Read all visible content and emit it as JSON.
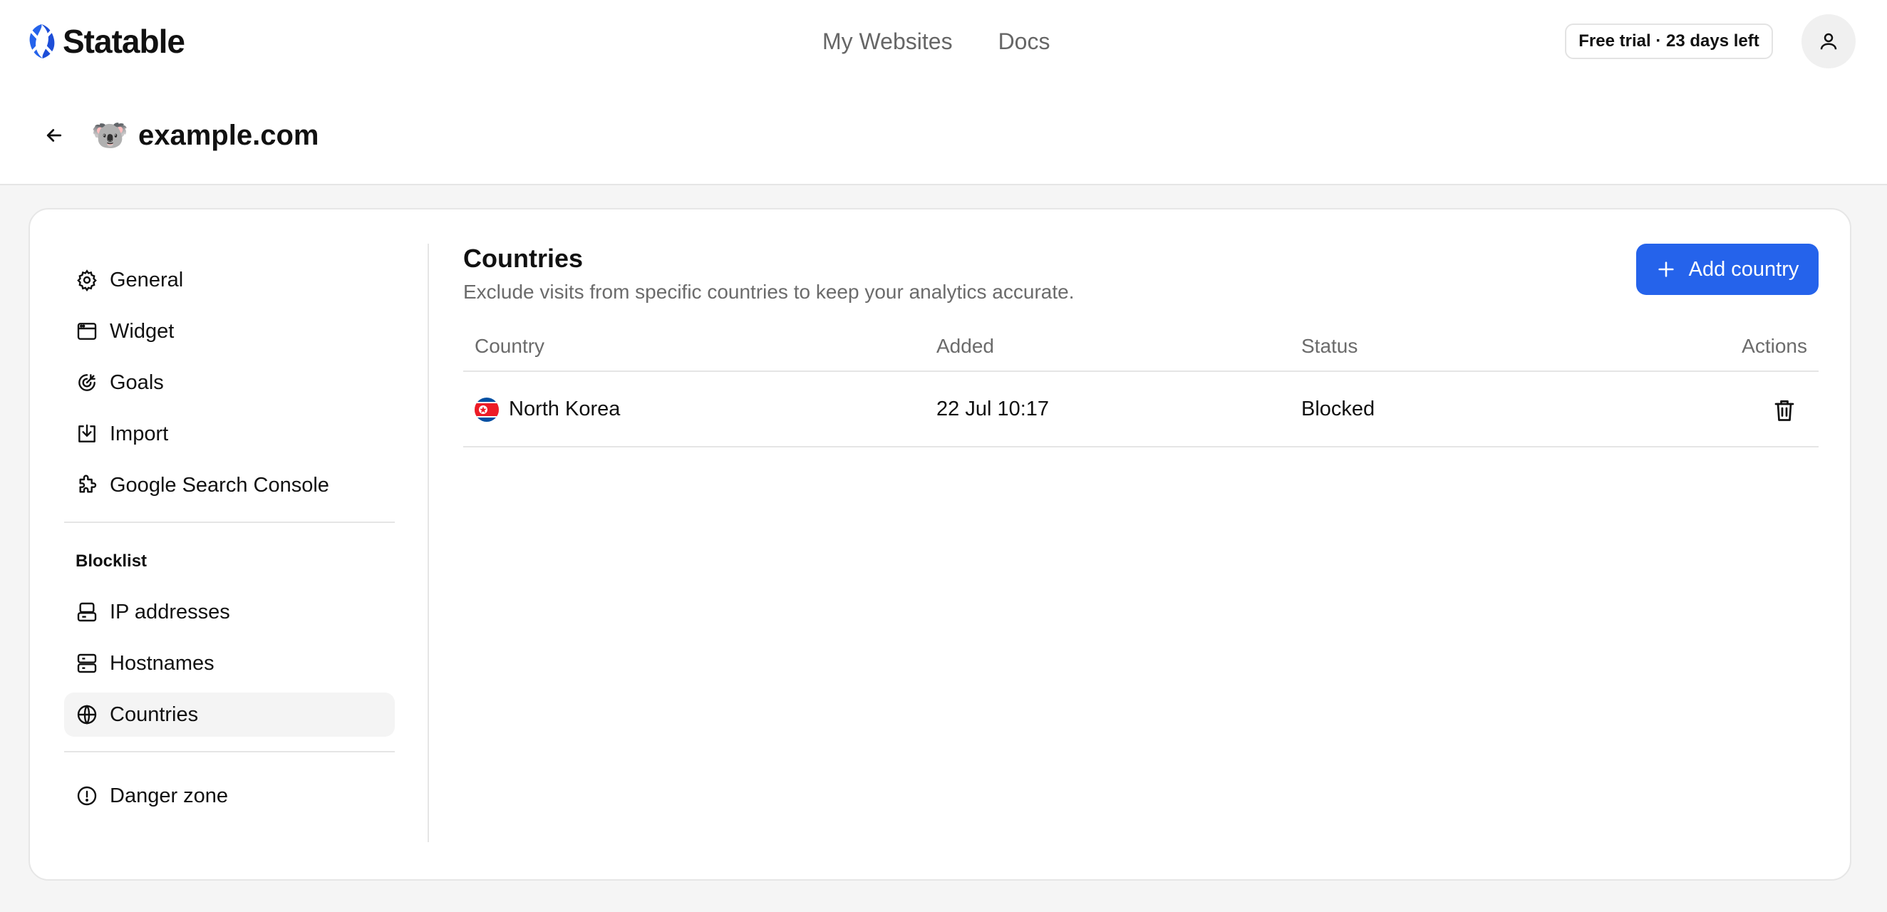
{
  "header": {
    "brand": "Statable",
    "nav": [
      "My Websites",
      "Docs"
    ],
    "trial_badge": "Free trial · 23 days left",
    "brand_color": "#2563eb"
  },
  "site": {
    "emoji": "🐨",
    "name": "example.com"
  },
  "sidebar": {
    "items": [
      {
        "label": "General",
        "icon": "gear-icon"
      },
      {
        "label": "Widget",
        "icon": "browser-window-icon"
      },
      {
        "label": "Goals",
        "icon": "target-icon"
      },
      {
        "label": "Import",
        "icon": "import-icon"
      },
      {
        "label": "Google Search Console",
        "icon": "puzzle-icon"
      }
    ],
    "blocklist_heading": "Blocklist",
    "blocklist_items": [
      {
        "label": "IP addresses",
        "icon": "ip-address-icon"
      },
      {
        "label": "Hostnames",
        "icon": "server-icon"
      },
      {
        "label": "Countries",
        "icon": "globe-icon",
        "active": true
      }
    ],
    "danger_item": {
      "label": "Danger zone",
      "icon": "alert-circle-icon"
    }
  },
  "main": {
    "title": "Countries",
    "subtitle": "Exclude visits from specific countries to keep your analytics accurate.",
    "add_button": "Add country",
    "table": {
      "columns": [
        "Country",
        "Added",
        "Status",
        "Actions"
      ],
      "rows": [
        {
          "country": "North Korea",
          "added": "22 Jul 10:17",
          "status": "Blocked",
          "flag": "north-korea-flag-icon"
        }
      ]
    }
  }
}
